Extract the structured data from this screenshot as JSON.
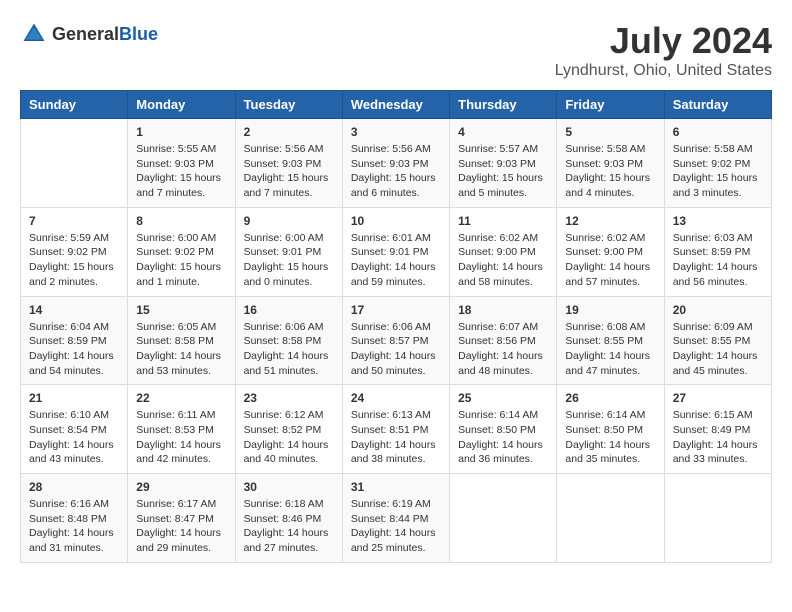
{
  "header": {
    "logo_general": "General",
    "logo_blue": "Blue",
    "month_year": "July 2024",
    "location": "Lyndhurst, Ohio, United States"
  },
  "weekdays": [
    "Sunday",
    "Monday",
    "Tuesday",
    "Wednesday",
    "Thursday",
    "Friday",
    "Saturday"
  ],
  "weeks": [
    [
      {
        "day": "",
        "info": ""
      },
      {
        "day": "1",
        "info": "Sunrise: 5:55 AM\nSunset: 9:03 PM\nDaylight: 15 hours\nand 7 minutes."
      },
      {
        "day": "2",
        "info": "Sunrise: 5:56 AM\nSunset: 9:03 PM\nDaylight: 15 hours\nand 7 minutes."
      },
      {
        "day": "3",
        "info": "Sunrise: 5:56 AM\nSunset: 9:03 PM\nDaylight: 15 hours\nand 6 minutes."
      },
      {
        "day": "4",
        "info": "Sunrise: 5:57 AM\nSunset: 9:03 PM\nDaylight: 15 hours\nand 5 minutes."
      },
      {
        "day": "5",
        "info": "Sunrise: 5:58 AM\nSunset: 9:03 PM\nDaylight: 15 hours\nand 4 minutes."
      },
      {
        "day": "6",
        "info": "Sunrise: 5:58 AM\nSunset: 9:02 PM\nDaylight: 15 hours\nand 3 minutes."
      }
    ],
    [
      {
        "day": "7",
        "info": "Sunrise: 5:59 AM\nSunset: 9:02 PM\nDaylight: 15 hours\nand 2 minutes."
      },
      {
        "day": "8",
        "info": "Sunrise: 6:00 AM\nSunset: 9:02 PM\nDaylight: 15 hours\nand 1 minute."
      },
      {
        "day": "9",
        "info": "Sunrise: 6:00 AM\nSunset: 9:01 PM\nDaylight: 15 hours\nand 0 minutes."
      },
      {
        "day": "10",
        "info": "Sunrise: 6:01 AM\nSunset: 9:01 PM\nDaylight: 14 hours\nand 59 minutes."
      },
      {
        "day": "11",
        "info": "Sunrise: 6:02 AM\nSunset: 9:00 PM\nDaylight: 14 hours\nand 58 minutes."
      },
      {
        "day": "12",
        "info": "Sunrise: 6:02 AM\nSunset: 9:00 PM\nDaylight: 14 hours\nand 57 minutes."
      },
      {
        "day": "13",
        "info": "Sunrise: 6:03 AM\nSunset: 8:59 PM\nDaylight: 14 hours\nand 56 minutes."
      }
    ],
    [
      {
        "day": "14",
        "info": "Sunrise: 6:04 AM\nSunset: 8:59 PM\nDaylight: 14 hours\nand 54 minutes."
      },
      {
        "day": "15",
        "info": "Sunrise: 6:05 AM\nSunset: 8:58 PM\nDaylight: 14 hours\nand 53 minutes."
      },
      {
        "day": "16",
        "info": "Sunrise: 6:06 AM\nSunset: 8:58 PM\nDaylight: 14 hours\nand 51 minutes."
      },
      {
        "day": "17",
        "info": "Sunrise: 6:06 AM\nSunset: 8:57 PM\nDaylight: 14 hours\nand 50 minutes."
      },
      {
        "day": "18",
        "info": "Sunrise: 6:07 AM\nSunset: 8:56 PM\nDaylight: 14 hours\nand 48 minutes."
      },
      {
        "day": "19",
        "info": "Sunrise: 6:08 AM\nSunset: 8:55 PM\nDaylight: 14 hours\nand 47 minutes."
      },
      {
        "day": "20",
        "info": "Sunrise: 6:09 AM\nSunset: 8:55 PM\nDaylight: 14 hours\nand 45 minutes."
      }
    ],
    [
      {
        "day": "21",
        "info": "Sunrise: 6:10 AM\nSunset: 8:54 PM\nDaylight: 14 hours\nand 43 minutes."
      },
      {
        "day": "22",
        "info": "Sunrise: 6:11 AM\nSunset: 8:53 PM\nDaylight: 14 hours\nand 42 minutes."
      },
      {
        "day": "23",
        "info": "Sunrise: 6:12 AM\nSunset: 8:52 PM\nDaylight: 14 hours\nand 40 minutes."
      },
      {
        "day": "24",
        "info": "Sunrise: 6:13 AM\nSunset: 8:51 PM\nDaylight: 14 hours\nand 38 minutes."
      },
      {
        "day": "25",
        "info": "Sunrise: 6:14 AM\nSunset: 8:50 PM\nDaylight: 14 hours\nand 36 minutes."
      },
      {
        "day": "26",
        "info": "Sunrise: 6:14 AM\nSunset: 8:50 PM\nDaylight: 14 hours\nand 35 minutes."
      },
      {
        "day": "27",
        "info": "Sunrise: 6:15 AM\nSunset: 8:49 PM\nDaylight: 14 hours\nand 33 minutes."
      }
    ],
    [
      {
        "day": "28",
        "info": "Sunrise: 6:16 AM\nSunset: 8:48 PM\nDaylight: 14 hours\nand 31 minutes."
      },
      {
        "day": "29",
        "info": "Sunrise: 6:17 AM\nSunset: 8:47 PM\nDaylight: 14 hours\nand 29 minutes."
      },
      {
        "day": "30",
        "info": "Sunrise: 6:18 AM\nSunset: 8:46 PM\nDaylight: 14 hours\nand 27 minutes."
      },
      {
        "day": "31",
        "info": "Sunrise: 6:19 AM\nSunset: 8:44 PM\nDaylight: 14 hours\nand 25 minutes."
      },
      {
        "day": "",
        "info": ""
      },
      {
        "day": "",
        "info": ""
      },
      {
        "day": "",
        "info": ""
      }
    ]
  ]
}
